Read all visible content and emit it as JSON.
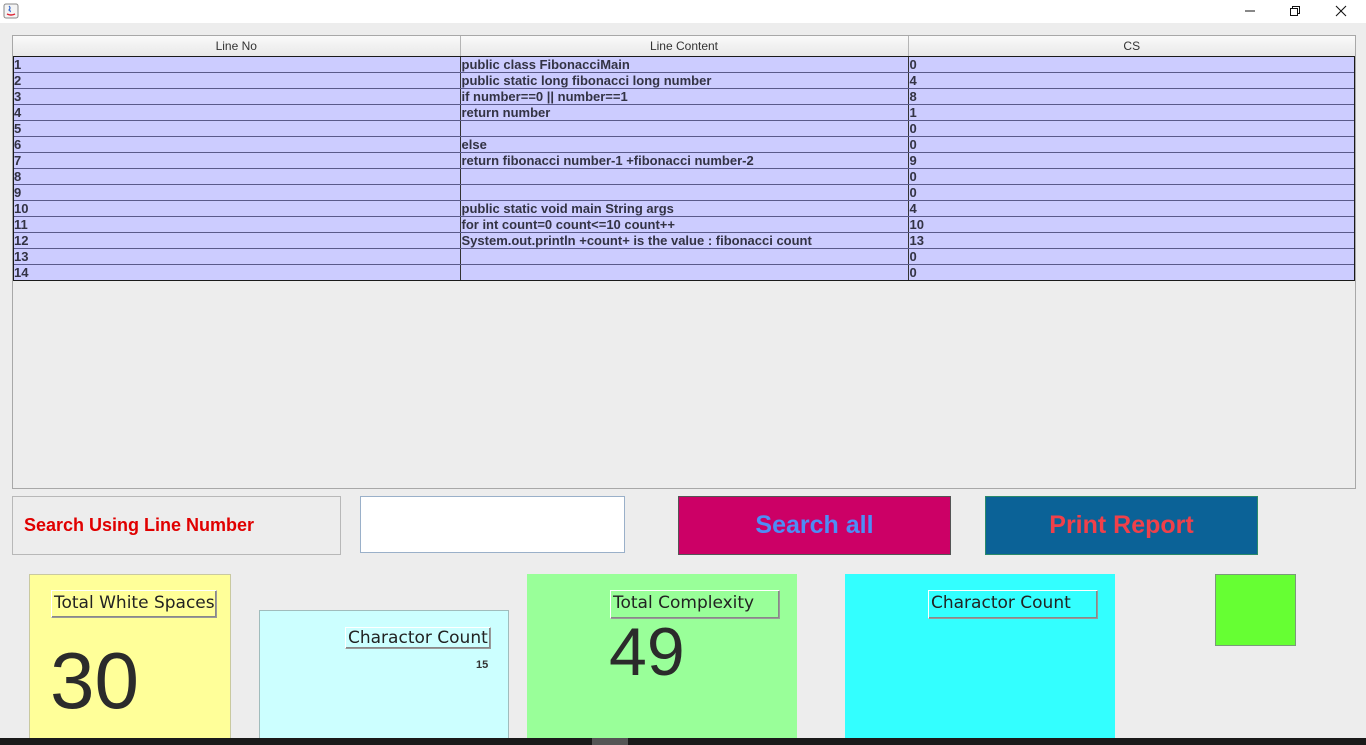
{
  "window": {
    "minimize_glyph": "─",
    "close_glyph": "✕"
  },
  "table": {
    "columns": [
      "Line No",
      "Line Content",
      "CS"
    ],
    "rows": [
      [
        "1",
        "public class FibonacciMain",
        "0"
      ],
      [
        "2",
        "public static long fibonacci long number",
        "4"
      ],
      [
        "3",
        "if  number==0 ||  number==1",
        "8"
      ],
      [
        "4",
        "return number",
        "1"
      ],
      [
        "5",
        "",
        "0"
      ],
      [
        "6",
        "else",
        "0"
      ],
      [
        "7",
        "return fibonacci number-1 +fibonacci number-2",
        "9"
      ],
      [
        "8",
        "",
        "0"
      ],
      [
        "9",
        "",
        "0"
      ],
      [
        "10",
        "public static void main String args",
        "4"
      ],
      [
        "11",
        "for int count=0 count<=10 count++",
        "10"
      ],
      [
        "12",
        "System.out.println +count+ is the value :  fibonacci count",
        "13"
      ],
      [
        "13",
        "",
        "0"
      ],
      [
        "14",
        "",
        "0"
      ]
    ]
  },
  "search": {
    "label": "Search Using Line Number",
    "input_value": "",
    "search_all_label": "Search all",
    "print_report_label": "Print Report"
  },
  "stats": {
    "white_spaces_label": "Total White Spaces",
    "white_spaces_value": "30",
    "char_count_label": "Charactor Count",
    "char_count_value": "15",
    "complexity_label": "Total Complexity",
    "complexity_value": "49",
    "char_count2_label": "Charactor Count"
  },
  "colors": {
    "row_bg": "#ccccff",
    "search_label": "#e00000",
    "search_btn_bg": "#cc0066",
    "search_btn_text": "#4d8df6",
    "print_btn_bg": "#0b6297",
    "print_btn_text": "#f0404a",
    "white_panel": "#ffff99",
    "char_panel": "#ccffff",
    "complexity_panel": "#99ff99",
    "char_panel2": "#33ffff",
    "green_box": "#66ff33"
  }
}
